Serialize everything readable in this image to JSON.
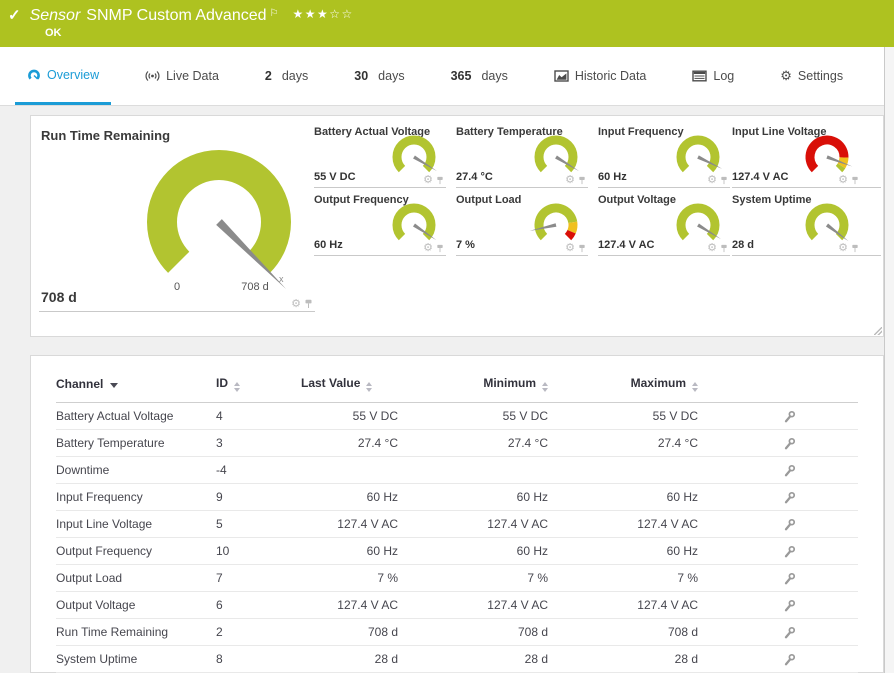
{
  "colors": {
    "header_bg": "#aec220",
    "accent_blue": "#1b9cd6",
    "gauge_green": "#b2c430",
    "gauge_yellow": "#f0c01e",
    "gauge_red": "#d90f08",
    "needle_gray": "#8b8b8b"
  },
  "icons": {
    "check": "✓",
    "flag": "⚐",
    "gear": "⚙",
    "stars_filled": "★★★",
    "stars_empty": "☆☆"
  },
  "header": {
    "kind": "Sensor",
    "title": "SNMP Custom Advanced",
    "status": "OK"
  },
  "tabs": {
    "overview": "Overview",
    "live_data": "Live Data",
    "d2_num": "2",
    "d2_label": "days",
    "d30_num": "30",
    "d30_label": "days",
    "d365_num": "365",
    "d365_label": "days",
    "historic": "Historic Data",
    "log": "Log",
    "settings": "Settings"
  },
  "gauges": {
    "main": {
      "title": "Run Time Remaining",
      "value": "708 d",
      "scale_min": "0",
      "scale_max": "708 d",
      "tip_label": "x",
      "needle_frac": 1.0,
      "segments": [
        {
          "from": 0,
          "to": 1,
          "color": "#b2c430"
        }
      ]
    },
    "small": [
      {
        "title": "Battery Actual Voltage",
        "value": "55 V DC",
        "needle_frac": 0.95,
        "segments": [
          {
            "from": 0,
            "to": 1,
            "color": "#b2c430"
          }
        ]
      },
      {
        "title": "Battery Temperature",
        "value": "27.4 °C",
        "needle_frac": 0.95,
        "segments": [
          {
            "from": 0,
            "to": 1,
            "color": "#b2c430"
          }
        ]
      },
      {
        "title": "Input Frequency",
        "value": "60 Hz",
        "needle_frac": 0.93,
        "segments": [
          {
            "from": 0,
            "to": 1,
            "color": "#b2c430"
          }
        ]
      },
      {
        "title": "Input Line Voltage",
        "value": "127.4 V AC",
        "needle_frac": 0.91,
        "segments": [
          {
            "from": 0,
            "to": 0.84,
            "color": "#d90f08"
          },
          {
            "from": 0.84,
            "to": 0.95,
            "color": "#f0c01e"
          },
          {
            "from": 0.95,
            "to": 1,
            "color": "#b2c430"
          }
        ]
      },
      {
        "title": "Output Frequency",
        "value": "60 Hz",
        "needle_frac": 0.96,
        "segments": [
          {
            "from": 0,
            "to": 1,
            "color": "#b2c430"
          }
        ]
      },
      {
        "title": "Output Load",
        "value": "7 %",
        "needle_frac": 0.12,
        "segments": [
          {
            "from": 0,
            "to": 0.8,
            "color": "#b2c430"
          },
          {
            "from": 0.8,
            "to": 0.92,
            "color": "#f0c01e"
          },
          {
            "from": 0.92,
            "to": 1,
            "color": "#d90f08"
          }
        ]
      },
      {
        "title": "Output Voltage",
        "value": "127.4 V AC",
        "needle_frac": 0.95,
        "segments": [
          {
            "from": 0,
            "to": 1,
            "color": "#b2c430"
          }
        ]
      },
      {
        "title": "System Uptime",
        "value": "28 d",
        "needle_frac": 0.97,
        "segments": [
          {
            "from": 0,
            "to": 1,
            "color": "#b2c430"
          }
        ]
      }
    ]
  },
  "table": {
    "columns": [
      {
        "label": "Channel"
      },
      {
        "label": "ID"
      },
      {
        "label": "Last Value"
      },
      {
        "label": "Minimum"
      },
      {
        "label": "Maximum"
      }
    ],
    "rows": [
      {
        "channel": "Battery Actual Voltage",
        "id": "4",
        "last": "55 V DC",
        "min": "55 V DC",
        "max": "55 V DC"
      },
      {
        "channel": "Battery Temperature",
        "id": "3",
        "last": "27.4 °C",
        "min": "27.4 °C",
        "max": "27.4 °C"
      },
      {
        "channel": "Downtime",
        "id": "-4",
        "last": "",
        "min": "",
        "max": ""
      },
      {
        "channel": "Input Frequency",
        "id": "9",
        "last": "60 Hz",
        "min": "60 Hz",
        "max": "60 Hz"
      },
      {
        "channel": "Input Line Voltage",
        "id": "5",
        "last": "127.4 V AC",
        "min": "127.4 V AC",
        "max": "127.4 V AC"
      },
      {
        "channel": "Output Frequency",
        "id": "10",
        "last": "60 Hz",
        "min": "60 Hz",
        "max": "60 Hz"
      },
      {
        "channel": "Output Load",
        "id": "7",
        "last": "7 %",
        "min": "7 %",
        "max": "7 %"
      },
      {
        "channel": "Output Voltage",
        "id": "6",
        "last": "127.4 V AC",
        "min": "127.4 V AC",
        "max": "127.4 V AC"
      },
      {
        "channel": "Run Time Remaining",
        "id": "2",
        "last": "708 d",
        "min": "708 d",
        "max": "708 d"
      },
      {
        "channel": "System Uptime",
        "id": "8",
        "last": "28 d",
        "min": "28 d",
        "max": "28 d"
      }
    ]
  }
}
